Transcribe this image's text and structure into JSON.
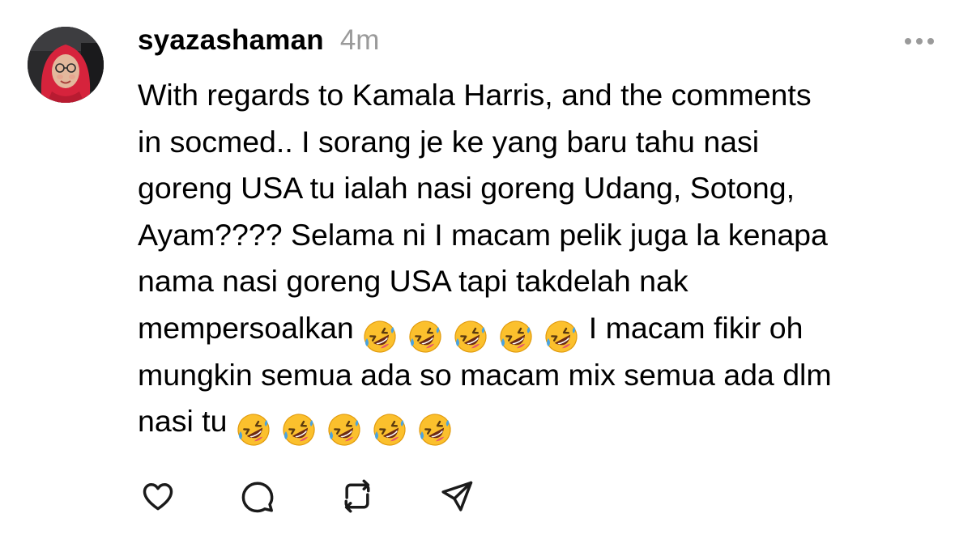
{
  "post": {
    "username": "syazashaman",
    "timestamp": "4m",
    "text_lines": {
      "l1": "With regards to Kamala Harris, and the comments",
      "l2": "in socmed.. I sorang je ke yang baru tahu nasi",
      "l3": "goreng USA tu ialah nasi goreng Udang, Sotong,",
      "l4": "Ayam???? Selama ni I macam pelik juga la kenapa",
      "l5": "nama nasi goreng USA tapi takdelah nak",
      "l6a": "mempersoalkan",
      "l6b": "I macam fikir oh",
      "l7": "mungkin semua ada so macam mix semua ada dlm",
      "l8": "nasi tu"
    },
    "emoji": "rolling-on-the-floor-laughing",
    "emoji_count_line6": 5,
    "emoji_count_line8": 5
  },
  "actions": {
    "like": "heart-icon",
    "reply": "comment-icon",
    "repost": "repost-icon",
    "share": "send-icon"
  },
  "more": "more-options-icon",
  "colors": {
    "timestamp": "#9a9a9a",
    "icons": "#1a1a1a",
    "avatar_hijab": "#d6233c",
    "emoji_face": "#fbc02d"
  }
}
